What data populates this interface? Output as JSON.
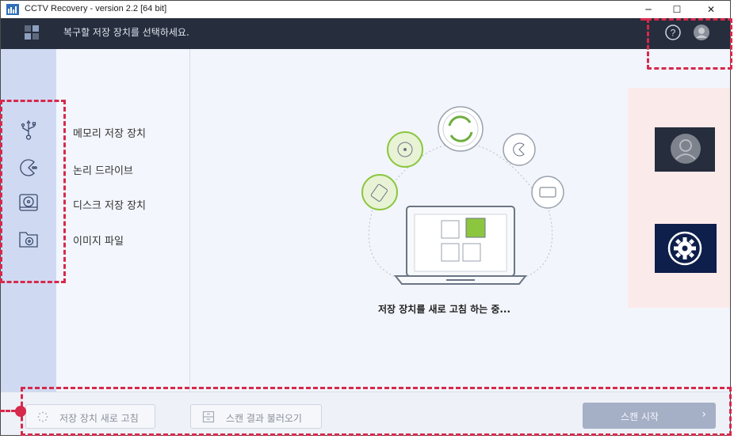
{
  "window": {
    "title": "CCTV Recovery - version 2.2 [64 bit]",
    "controls": {
      "minimize": "─",
      "maximize": "☐",
      "close": "✕"
    }
  },
  "header": {
    "title": "복구할 저장 장치를 선택하세요."
  },
  "devices": [
    {
      "label": "메모리 저장 장치",
      "icon": "usb-icon"
    },
    {
      "label": "논리 드라이브",
      "icon": "partition-icon"
    },
    {
      "label": "디스크 저장 장치",
      "icon": "disk-icon"
    },
    {
      "label": "이미지 파일",
      "icon": "image-folder-icon"
    }
  ],
  "main": {
    "status": "저장 장치를 새로 고침 하는 중..."
  },
  "footer": {
    "refresh_label": "저장 장치 새로 고침",
    "load_scan_label": "스캔 결과 불러오기",
    "start_scan_label": "스캔 시작",
    "start_scan_arrow": "›"
  },
  "callout": {
    "fragment_1": "",
    "fragment_2": ""
  },
  "colors": {
    "header_bg": "#262d3c",
    "sidebar_bg": "#cfdaf2",
    "accent_green": "#8cc63f",
    "annotation_red": "#d6294c",
    "scan_button": "#a5b0c7"
  }
}
